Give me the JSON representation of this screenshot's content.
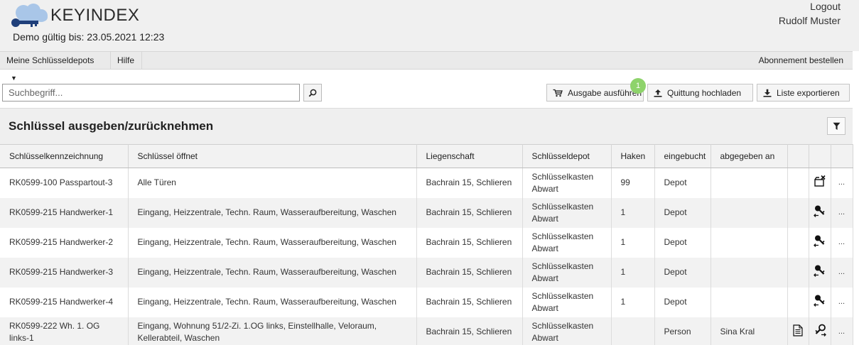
{
  "header": {
    "brand": "KEYINDEX",
    "demo": "Demo gültig bis: 23.05.2021 12:23",
    "logout": "Logout",
    "username": "Rudolf Muster"
  },
  "nav": {
    "depots": "Meine Schlüsseldepots",
    "hilfe": "Hilfe",
    "abo": "Abonnement bestellen"
  },
  "toolbar": {
    "search_placeholder": "Suchbegriff...",
    "search_value": "",
    "ausgabe": "Ausgabe ausführen",
    "badge": "1",
    "quittung": "Quittung hochladen",
    "liste": "Liste exportieren"
  },
  "panel": {
    "title": "Schlüssel ausgeben/zurücknehmen"
  },
  "table": {
    "columns": [
      "Schlüsselkennzeichnung",
      "Schlüssel öffnet",
      "Liegenschaft",
      "Schlüsseldepot",
      "Haken",
      "eingebucht",
      "abgegeben an",
      "",
      "",
      ""
    ],
    "rows": [
      {
        "kennzeichnung": "RK0599-100 Passpartout-3",
        "oeffnet": "Alle Türen",
        "liegenschaft": "Bachrain 15, Schlieren",
        "depot": "Schlüsselkasten Abwart",
        "haken": "99",
        "eingebucht": "Depot",
        "abgegeben": "",
        "doc_icon": "",
        "action_icon": "key-unavailable-icon",
        "more": "..."
      },
      {
        "kennzeichnung": "RK0599-215 Handwerker-1",
        "oeffnet": "Eingang, Heizzentrale, Techn. Raum, Wasseraufbereitung, Waschen",
        "liegenschaft": "Bachrain 15, Schlieren",
        "depot": "Schlüsselkasten Abwart",
        "haken": "1",
        "eingebucht": "Depot",
        "abgegeben": "",
        "doc_icon": "",
        "action_icon": "key-issue-icon",
        "more": "..."
      },
      {
        "kennzeichnung": "RK0599-215 Handwerker-2",
        "oeffnet": "Eingang, Heizzentrale, Techn. Raum, Wasseraufbereitung, Waschen",
        "liegenschaft": "Bachrain 15, Schlieren",
        "depot": "Schlüsselkasten Abwart",
        "haken": "1",
        "eingebucht": "Depot",
        "abgegeben": "",
        "doc_icon": "",
        "action_icon": "key-issue-icon",
        "more": "..."
      },
      {
        "kennzeichnung": "RK0599-215 Handwerker-3",
        "oeffnet": "Eingang, Heizzentrale, Techn. Raum, Wasseraufbereitung, Waschen",
        "liegenschaft": "Bachrain 15, Schlieren",
        "depot": "Schlüsselkasten Abwart",
        "haken": "1",
        "eingebucht": "Depot",
        "abgegeben": "",
        "doc_icon": "",
        "action_icon": "key-issue-icon",
        "more": "..."
      },
      {
        "kennzeichnung": "RK0599-215 Handwerker-4",
        "oeffnet": "Eingang, Heizzentrale, Techn. Raum, Wasseraufbereitung, Waschen",
        "liegenschaft": "Bachrain 15, Schlieren",
        "depot": "Schlüsselkasten Abwart",
        "haken": "1",
        "eingebucht": "Depot",
        "abgegeben": "",
        "doc_icon": "",
        "action_icon": "key-issue-icon",
        "more": "..."
      },
      {
        "kennzeichnung": "RK0599-222 Wh. 1. OG links-1",
        "oeffnet": "Eingang, Wohnung 51/2-Zi. 1.OG links, Einstellhalle, Veloraum, Kellerabteil, Waschen",
        "liegenschaft": "Bachrain 15, Schlieren",
        "depot": "Schlüsselkasten Abwart",
        "haken": "",
        "eingebucht": "Person",
        "abgegeben": "Sina Kral",
        "doc_icon": "document-icon",
        "action_icon": "key-return-icon",
        "more": "..."
      }
    ]
  },
  "colors": {
    "logo_cloud": "#a9c6e8",
    "logo_key": "#1f3f7a",
    "badge": "#8ed36b",
    "header_bg": "#f0f0f0"
  }
}
